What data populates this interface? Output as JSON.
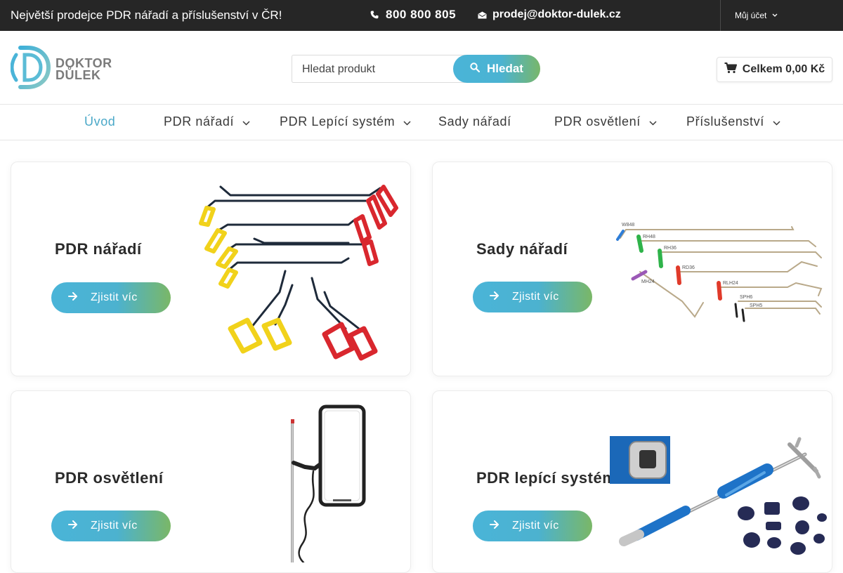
{
  "topbar": {
    "promo": "Největší prodejce PDR nářadí a příslušenství v ČR!",
    "phone": "800 800 805",
    "email": "prodej@doktor-dulek.cz",
    "account": "Můj účet"
  },
  "header": {
    "logo_line1": "DOKTOR",
    "logo_line2": "DŮLEK",
    "search_placeholder": "Hledat produkt",
    "search_button": "Hledat",
    "cart": "Celkem 0,00 Kč"
  },
  "nav": {
    "items": [
      {
        "label": "Úvod"
      },
      {
        "label": "PDR nářadí"
      },
      {
        "label": "PDR Lepící systém"
      },
      {
        "label": "Sady nářadí"
      },
      {
        "label": "PDR osvětlení"
      },
      {
        "label": "Příslušenství"
      }
    ]
  },
  "cards": [
    {
      "title": "PDR nářadí",
      "cta": "Zjistit víc"
    },
    {
      "title": "Sady nářadí",
      "cta": "Zjistit víc"
    },
    {
      "title": "PDR osvětlení",
      "cta": "Zjistit víc"
    },
    {
      "title": "PDR lepící systém",
      "cta": "Zjistit víc"
    }
  ],
  "tool_labels": [
    "W848",
    "RH48",
    "RH36",
    "RD36",
    "MH24",
    "RLH24",
    "SPH6",
    "SPH5"
  ],
  "colors": {
    "topbar_bg": "#262626",
    "accent_blue": "#4ab4d8",
    "accent_green": "#7ab767",
    "nav_active": "#4aa8c8"
  }
}
